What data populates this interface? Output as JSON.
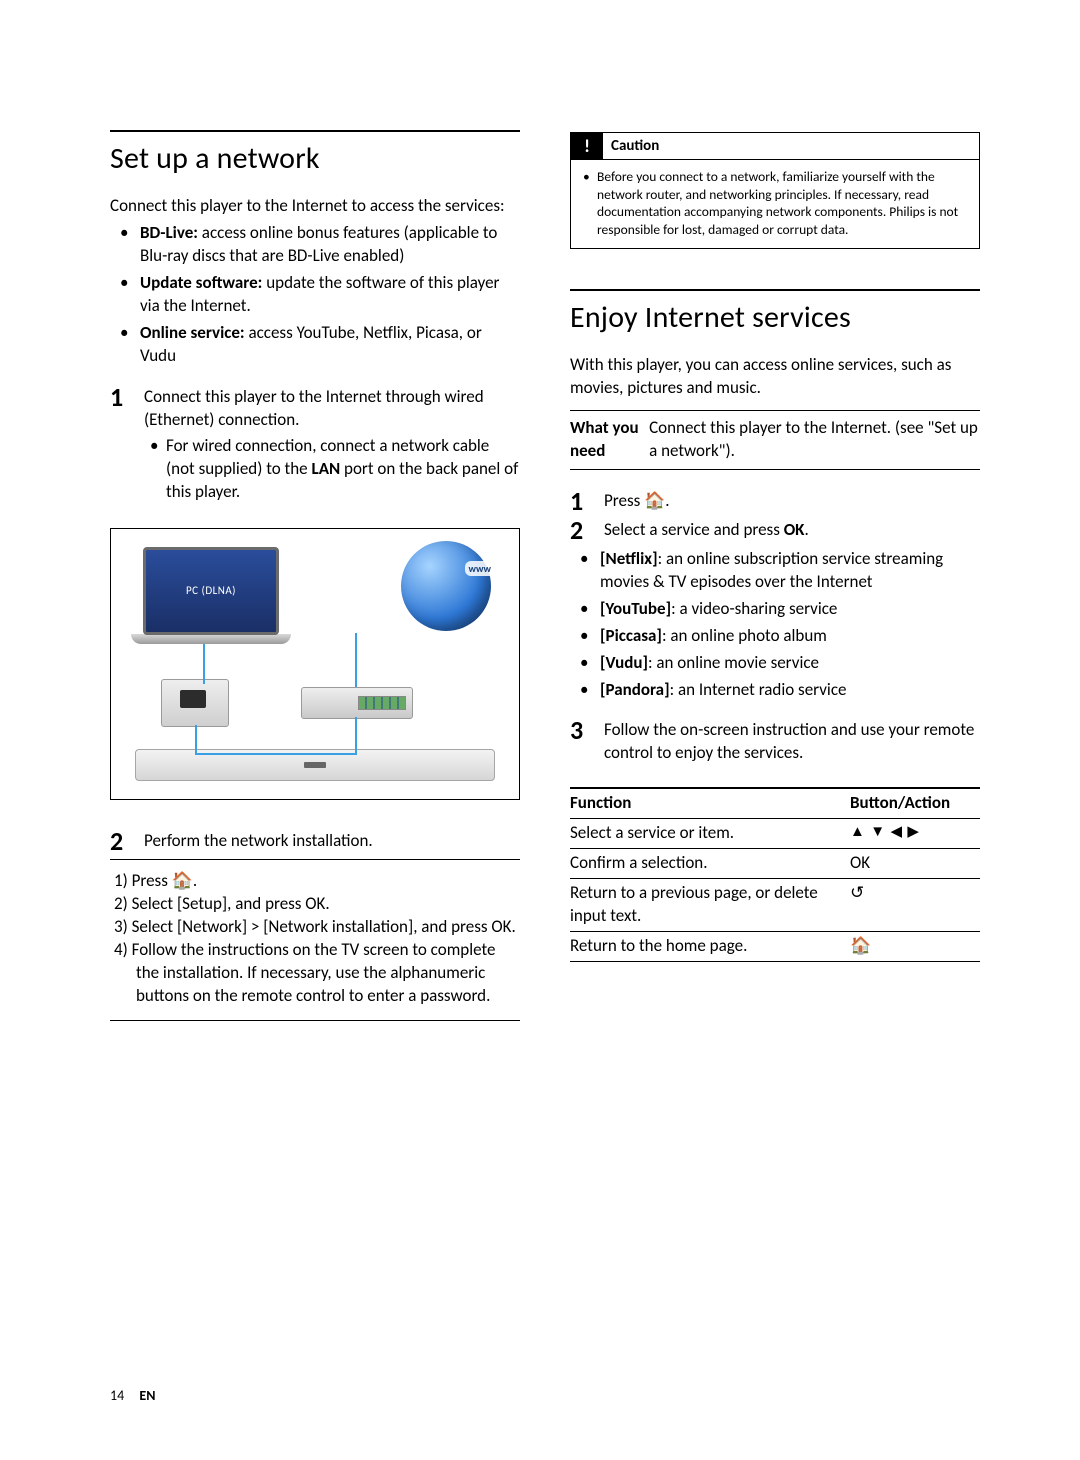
{
  "left": {
    "heading": "Set up a network",
    "intro": "Connect this player to the Internet to access the services:",
    "bullets": [
      {
        "bold": "BD-Live:",
        "rest": " access online bonus features (applicable to Blu-ray discs that are BD-Live enabled)"
      },
      {
        "bold": "Update software:",
        "rest": " update the software of this player via the Internet."
      },
      {
        "bold": "Online service:",
        "rest": " access YouTube, Netflix, Picasa, or Vudu"
      }
    ],
    "step1": "Connect this player to the Internet through wired (Ethernet) connection.",
    "step1_sub_html": "For wired connection, connect a network cable (not supplied) to the <span class=\"b\">LAN</span> port on the back panel of this player.",
    "diagram": {
      "pc_label": "PC (DLNA)",
      "www_label": "www"
    },
    "step2": "Perform the network installation.",
    "substeps": [
      "1) Press 🏠.",
      "2) Select [Setup], and press OK.",
      "3) Select [Network] > [Network installation], and press OK.",
      "4) Follow the instructions on the TV screen to complete the installation. If necessary, use the alphanumeric buttons on the remote control to enter a password."
    ]
  },
  "right": {
    "caution_label": "Caution",
    "caution_body": "Before you connect to a network, familiarize yourself with the network router, and networking principles. If necessary, read documentation accompanying network components. Philips is not responsible for lost, damaged or corrupt data.",
    "heading": "Enjoy Internet services",
    "intro": "With this player, you can access online services, such as movies, pictures and music.",
    "need_key": "What you need",
    "need_val": "Connect this player to the Internet. (see \"Set up a network\").",
    "step1": "Press 🏠.",
    "step2_html": "Select a service and press <span class=\"b\">OK</span>.",
    "services": [
      {
        "bold": "[Netflix]",
        "rest": ": an online subscription service streaming movies & TV episodes over the Internet"
      },
      {
        "bold": "[YouTube]",
        "rest": ": a video-sharing service"
      },
      {
        "bold": "[Piccasa]",
        "rest": ": an online photo album"
      },
      {
        "bold": "[Vudu]",
        "rest": ": an online movie service"
      },
      {
        "bold": "[Pandora]",
        "rest": ": an Internet radio service"
      }
    ],
    "step3": "Follow the on-screen instruction and use your remote control to enjoy the services.",
    "func_header_f": "Function",
    "func_header_a": "Button/Action",
    "func_rows": [
      {
        "f": "Select a service or item.",
        "a": "▲ ▼ ◀ ▶"
      },
      {
        "f": "Confirm a selection.",
        "a": "OK"
      },
      {
        "f": "Return to a previous page, or delete input text.",
        "a": "↺"
      },
      {
        "f": "Return to the home page.",
        "a": "🏠"
      }
    ]
  },
  "footer": {
    "page": "14",
    "lang": "EN"
  }
}
